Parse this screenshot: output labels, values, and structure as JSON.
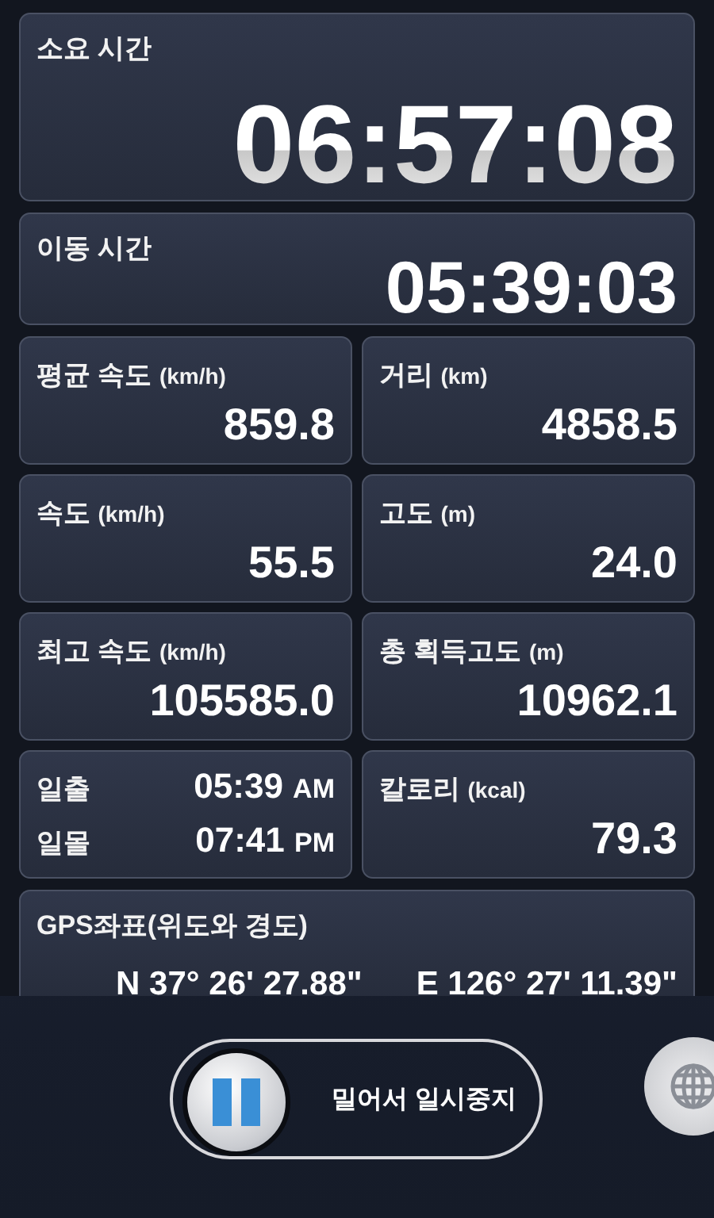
{
  "total_time": {
    "label": "소요 시간",
    "value": "06:57:08"
  },
  "moving_time": {
    "label": "이동 시간",
    "value": "05:39:03"
  },
  "stats": [
    {
      "kind": "metric",
      "label": "평균 속도",
      "unit": "(km/h)",
      "value": "859.8"
    },
    {
      "kind": "metric",
      "label": "거리",
      "unit": "(km)",
      "value": "4858.5"
    },
    {
      "kind": "metric",
      "label": "속도",
      "unit": "(km/h)",
      "value": "55.5"
    },
    {
      "kind": "metric",
      "label": "고도",
      "unit": "(m)",
      "value": "24.0"
    },
    {
      "kind": "metric",
      "label": "최고 속도",
      "unit": "(km/h)",
      "value": "105585.0"
    },
    {
      "kind": "metric",
      "label": "총 획득고도",
      "unit": "(m)",
      "value": "10962.1"
    },
    {
      "kind": "sun",
      "rows": [
        {
          "label": "일출",
          "time": "05:39",
          "period": "AM"
        },
        {
          "label": "일몰",
          "time": "07:41",
          "period": "PM"
        }
      ]
    },
    {
      "kind": "metric",
      "label": "칼로리",
      "unit": "(kcal)",
      "value": "79.3"
    }
  ],
  "gps": {
    "label": "GPS좌표(위도와 경도)",
    "latitude": "N 37° 26' 27.88\"",
    "longitude": "E 126° 27' 11.39\""
  },
  "pause_slider": {
    "label": "밀어서 일시중지",
    "level": 0
  }
}
